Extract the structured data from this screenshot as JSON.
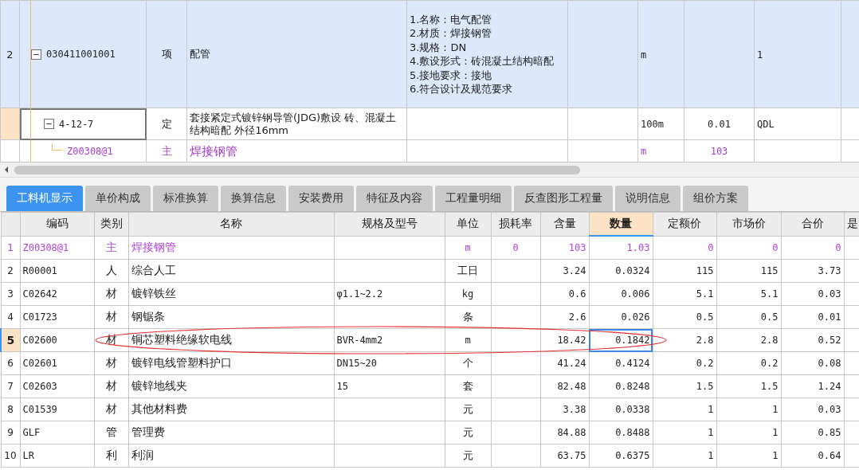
{
  "upper_table": {
    "rows": [
      {
        "kind": "bill",
        "row_number": "2",
        "expanded": true,
        "selected": false,
        "code": "030411001001",
        "type": "项",
        "name": "配管",
        "description": [
          "1.名称：电气配管",
          "2.材质：焊接钢管",
          "3.规格：DN",
          "4.敷设形式：砖混凝土结构暗配",
          "5.接地要求：接地",
          "6.符合设计及规范要求"
        ],
        "unit": "m",
        "quantity": "",
        "column_9": "1"
      },
      {
        "kind": "quota",
        "row_number": "",
        "expanded": true,
        "selected": true,
        "code": "4-12-7",
        "type": "定",
        "name": "套接紧定式镀锌钢导管(JDG)敷设 砖、混凝土结构暗配 外径16mm",
        "description": [],
        "unit": "100m",
        "quantity": "0.01",
        "column_9": "QDL"
      },
      {
        "kind": "material",
        "row_number": "",
        "selected": false,
        "code": "Z00308@1",
        "type": "主",
        "name": "焊接钢管",
        "description": [],
        "unit": "m",
        "quantity": "103",
        "column_9": ""
      }
    ]
  },
  "tabs": [
    {
      "label": "工料机显示",
      "selected": true
    },
    {
      "label": "单价构成",
      "selected": false
    },
    {
      "label": "标准换算",
      "selected": false
    },
    {
      "label": "换算信息",
      "selected": false
    },
    {
      "label": "安装费用",
      "selected": false
    },
    {
      "label": "特征及内容",
      "selected": false
    },
    {
      "label": "工程量明细",
      "selected": false
    },
    {
      "label": "反查图形工程量",
      "selected": false
    },
    {
      "label": "说明信息",
      "selected": false
    },
    {
      "label": "组价方案",
      "selected": false
    }
  ],
  "lower_table": {
    "columns": [
      {
        "label": "编码",
        "selected": false
      },
      {
        "label": "类别",
        "selected": false
      },
      {
        "label": "名称",
        "selected": false
      },
      {
        "label": "规格及型号",
        "selected": false
      },
      {
        "label": "单位",
        "selected": false
      },
      {
        "label": "损耗率",
        "selected": false
      },
      {
        "label": "含量",
        "selected": false
      },
      {
        "label": "数量",
        "selected": true
      },
      {
        "label": "定额价",
        "selected": false
      },
      {
        "label": "市场价",
        "selected": false
      },
      {
        "label": "合价",
        "selected": false
      },
      {
        "label": "是",
        "selected": false
      }
    ],
    "rows": [
      {
        "row_number": "1",
        "kind": "main",
        "selected": false,
        "cells": [
          "Z00308@1",
          "主",
          "焊接钢管",
          "",
          "m",
          "0",
          "103",
          "1.03",
          "0",
          "0",
          "0"
        ]
      },
      {
        "row_number": "2",
        "kind": "normal",
        "selected": false,
        "cells": [
          "R00001",
          "人",
          "综合人工",
          "",
          "工日",
          "",
          "3.24",
          "0.0324",
          "115",
          "115",
          "3.73"
        ]
      },
      {
        "row_number": "3",
        "kind": "normal",
        "selected": false,
        "cells": [
          "C02642",
          "材",
          "镀锌铁丝",
          "φ1.1~2.2",
          "kg",
          "",
          "0.6",
          "0.006",
          "5.1",
          "5.1",
          "0.03"
        ]
      },
      {
        "row_number": "4",
        "kind": "normal",
        "selected": false,
        "cells": [
          "C01723",
          "材",
          "钢锯条",
          "",
          "条",
          "",
          "2.6",
          "0.026",
          "0.5",
          "0.5",
          "0.01"
        ]
      },
      {
        "row_number": "5",
        "kind": "normal",
        "selected": true,
        "cells": [
          "C02600",
          "材",
          "铜芯塑料绝缘软电线",
          "BVR-4mm2",
          "m",
          "",
          "18.42",
          "0.1842",
          "2.8",
          "2.8",
          "0.52"
        ]
      },
      {
        "row_number": "6",
        "kind": "normal",
        "selected": false,
        "cells": [
          "C02601",
          "材",
          "镀锌电线管塑料护口",
          "DN15~20",
          "个",
          "",
          "41.24",
          "0.4124",
          "0.2",
          "0.2",
          "0.08"
        ]
      },
      {
        "row_number": "7",
        "kind": "normal",
        "selected": false,
        "cells": [
          "C02603",
          "材",
          "镀锌地线夹",
          "15",
          "套",
          "",
          "82.48",
          "0.8248",
          "1.5",
          "1.5",
          "1.24"
        ]
      },
      {
        "row_number": "8",
        "kind": "normal",
        "selected": false,
        "cells": [
          "C01539",
          "材",
          "其他材料费",
          "",
          "元",
          "",
          "3.38",
          "0.0338",
          "1",
          "1",
          "0.03"
        ]
      },
      {
        "row_number": "9",
        "kind": "normal",
        "selected": false,
        "cells": [
          "GLF",
          "管",
          "管理费",
          "",
          "元",
          "",
          "84.88",
          "0.8488",
          "1",
          "1",
          "0.85"
        ]
      },
      {
        "row_number": "10",
        "kind": "normal",
        "selected": false,
        "cells": [
          "LR",
          "利",
          "利润",
          "",
          "元",
          "",
          "63.75",
          "0.6375",
          "1",
          "1",
          "0.64"
        ]
      }
    ]
  }
}
